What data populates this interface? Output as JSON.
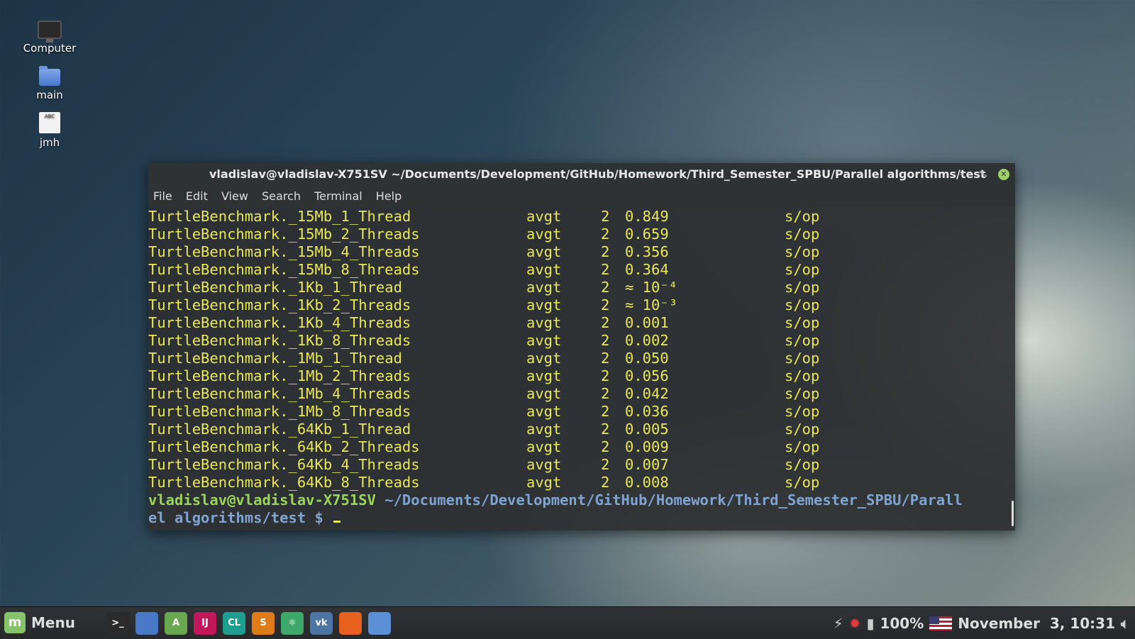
{
  "desktop": {
    "icons": [
      {
        "label": "Computer",
        "icon": "computer-icon"
      },
      {
        "label": "main",
        "icon": "folder-icon"
      },
      {
        "label": "jmh",
        "icon": "text-document-icon",
        "badge": "ABC"
      }
    ]
  },
  "terminal": {
    "title": "vladislav@vladislav-X751SV ~/Documents/Development/GitHub/Homework/Third_Semester_SPBU/Parallel algorithms/test",
    "controls": {
      "minimize": "–",
      "restore": "⤡",
      "close": "✕"
    },
    "menu": [
      "File",
      "Edit",
      "View",
      "Search",
      "Terminal",
      "Help"
    ],
    "rows": [
      {
        "name": "TurtleBenchmark._15Mb_1_Thread",
        "mode": "avgt",
        "cnt": "2",
        "score": "0.849",
        "units": "s/op"
      },
      {
        "name": "TurtleBenchmark._15Mb_2_Threads",
        "mode": "avgt",
        "cnt": "2",
        "score": "0.659",
        "units": "s/op"
      },
      {
        "name": "TurtleBenchmark._15Mb_4_Threads",
        "mode": "avgt",
        "cnt": "2",
        "score": "0.356",
        "units": "s/op"
      },
      {
        "name": "TurtleBenchmark._15Mb_8_Threads",
        "mode": "avgt",
        "cnt": "2",
        "score": "0.364",
        "units": "s/op"
      },
      {
        "name": "TurtleBenchmark._1Kb_1_Thread",
        "mode": "avgt",
        "cnt": "2",
        "score": "≈ 10⁻⁴",
        "units": "s/op"
      },
      {
        "name": "TurtleBenchmark._1Kb_2_Threads",
        "mode": "avgt",
        "cnt": "2",
        "score": "≈ 10⁻³",
        "units": "s/op"
      },
      {
        "name": "TurtleBenchmark._1Kb_4_Threads",
        "mode": "avgt",
        "cnt": "2",
        "score": "0.001",
        "units": "s/op"
      },
      {
        "name": "TurtleBenchmark._1Kb_8_Threads",
        "mode": "avgt",
        "cnt": "2",
        "score": "0.002",
        "units": "s/op"
      },
      {
        "name": "TurtleBenchmark._1Mb_1_Thread",
        "mode": "avgt",
        "cnt": "2",
        "score": "0.050",
        "units": "s/op"
      },
      {
        "name": "TurtleBenchmark._1Mb_2_Threads",
        "mode": "avgt",
        "cnt": "2",
        "score": "0.056",
        "units": "s/op"
      },
      {
        "name": "TurtleBenchmark._1Mb_4_Threads",
        "mode": "avgt",
        "cnt": "2",
        "score": "0.042",
        "units": "s/op"
      },
      {
        "name": "TurtleBenchmark._1Mb_8_Threads",
        "mode": "avgt",
        "cnt": "2",
        "score": "0.036",
        "units": "s/op"
      },
      {
        "name": "TurtleBenchmark._64Kb_1_Thread",
        "mode": "avgt",
        "cnt": "2",
        "score": "0.005",
        "units": "s/op"
      },
      {
        "name": "TurtleBenchmark._64Kb_2_Threads",
        "mode": "avgt",
        "cnt": "2",
        "score": "0.009",
        "units": "s/op"
      },
      {
        "name": "TurtleBenchmark._64Kb_4_Threads",
        "mode": "avgt",
        "cnt": "2",
        "score": "0.007",
        "units": "s/op"
      },
      {
        "name": "TurtleBenchmark._64Kb_8_Threads",
        "mode": "avgt",
        "cnt": "2",
        "score": "0.008",
        "units": "s/op"
      }
    ],
    "prompt": {
      "user_host": "vladislav@vladislav-X751SV",
      "path_line1": " ~/Documents/Development/GitHub/Homework/Third_Semester_SPBU/Parall",
      "path_line2": "el algorithms/test",
      "symbol": " $ "
    }
  },
  "taskbar": {
    "menu_label": "Menu",
    "launchers": [
      {
        "icon": "terminal-icon",
        "glyph": ">_"
      },
      {
        "icon": "home-folder-icon",
        "glyph": ""
      },
      {
        "icon": "android-studio-icon",
        "glyph": "A"
      },
      {
        "icon": "intellij-idea-icon",
        "glyph": "IJ"
      },
      {
        "icon": "clion-icon",
        "glyph": "CL"
      },
      {
        "icon": "sublime-text-icon",
        "glyph": "S"
      },
      {
        "icon": "atom-icon",
        "glyph": "⚛"
      },
      {
        "icon": "vk-icon",
        "glyph": "vk"
      },
      {
        "icon": "firefox-icon",
        "glyph": ""
      },
      {
        "icon": "chromium-icon",
        "glyph": ""
      }
    ],
    "tray": {
      "battery_percent": "100%",
      "datetime": "November  3, 10:31"
    }
  }
}
